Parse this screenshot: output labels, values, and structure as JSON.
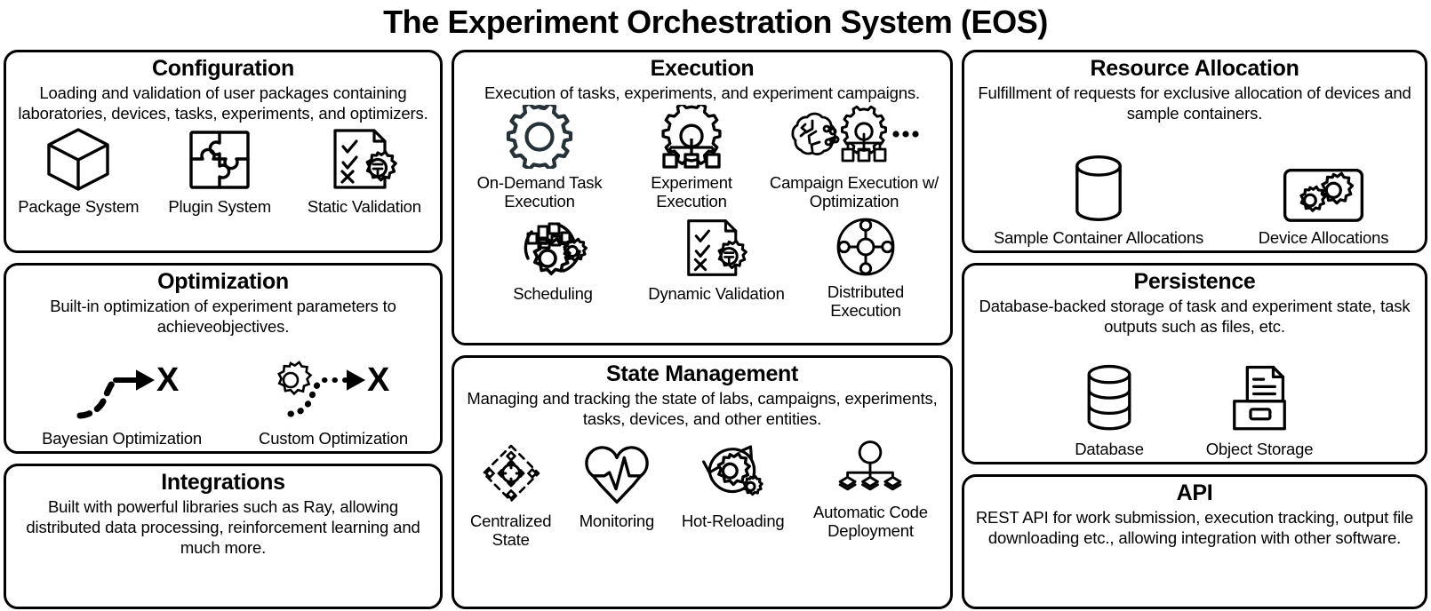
{
  "title": "The Experiment Orchestration System (EOS)",
  "panels": {
    "configuration": {
      "title": "Configuration",
      "description": "Loading and validation of user packages containing laboratories, devices, tasks, experiments, and optimizers.",
      "items": [
        {
          "label": "Package System",
          "icon": "cube-icon"
        },
        {
          "label": "Plugin System",
          "icon": "puzzle-icon"
        },
        {
          "label": "Static Validation",
          "icon": "checklist-gear-icon"
        }
      ]
    },
    "optimization": {
      "title": "Optimization",
      "description": "Built-in optimization of experiment parameters to achieveobjectives.",
      "items": [
        {
          "label": "Bayesian Optimization",
          "icon": "dashed-arrow-target-icon"
        },
        {
          "label": "Custom Optimization",
          "icon": "gear-dotted-arrow-target-icon"
        }
      ]
    },
    "integrations": {
      "title": "Integrations",
      "description": "Built with powerful libraries such as Ray, allowing distributed data processing, reinforcement learning and much more.",
      "items": []
    },
    "execution": {
      "title": "Execution",
      "description": "Execution of tasks, experiments, and experiment campaigns.",
      "items_row1": [
        {
          "label": "On-Demand Task Execution",
          "icon": "gear-icon"
        },
        {
          "label": "Experiment Execution",
          "icon": "gear-hierarchy-icon"
        },
        {
          "label": "Campaign Execution w/ Optimization",
          "icon": "brain-gear-hierarchy-ellipsis-icon"
        }
      ],
      "items_row2": [
        {
          "label": "Scheduling",
          "icon": "schedule-gears-icon"
        },
        {
          "label": "Dynamic Validation",
          "icon": "checklist-gear-icon"
        },
        {
          "label": "Distributed Execution",
          "icon": "distributed-node-icon"
        }
      ]
    },
    "state_management": {
      "title": "State Management",
      "description": "Managing and tracking the state of labs, campaigns, experiments, tasks, devices, and other entities.",
      "items": [
        {
          "label": "Centralized State",
          "icon": "centralized-state-icon"
        },
        {
          "label": "Monitoring",
          "icon": "heartbeat-icon"
        },
        {
          "label": "Hot-Reloading",
          "icon": "reload-gear-icon"
        },
        {
          "label": "Automatic Code Deployment",
          "icon": "deployment-tree-icon"
        }
      ]
    },
    "resource_allocation": {
      "title": "Resource Allocation",
      "description": "Fulfillment of requests for exclusive allocation of devices and sample containers.",
      "items": [
        {
          "label": "Sample Container Allocations",
          "icon": "cylinder-icon"
        },
        {
          "label": "Device Allocations",
          "icon": "device-gears-icon"
        }
      ]
    },
    "persistence": {
      "title": "Persistence",
      "description": "Database-backed storage of task and experiment state, task outputs such as files, etc.",
      "items": [
        {
          "label": "Database",
          "icon": "database-icon"
        },
        {
          "label": "Object Storage",
          "icon": "file-drawer-icon"
        }
      ]
    },
    "api": {
      "title": "API",
      "description": "REST API for work submission, execution tracking, output file downloading etc., allowing integration with  other software.",
      "items": []
    }
  },
  "colors": {
    "stroke": "#000000",
    "background": "#ffffff"
  }
}
